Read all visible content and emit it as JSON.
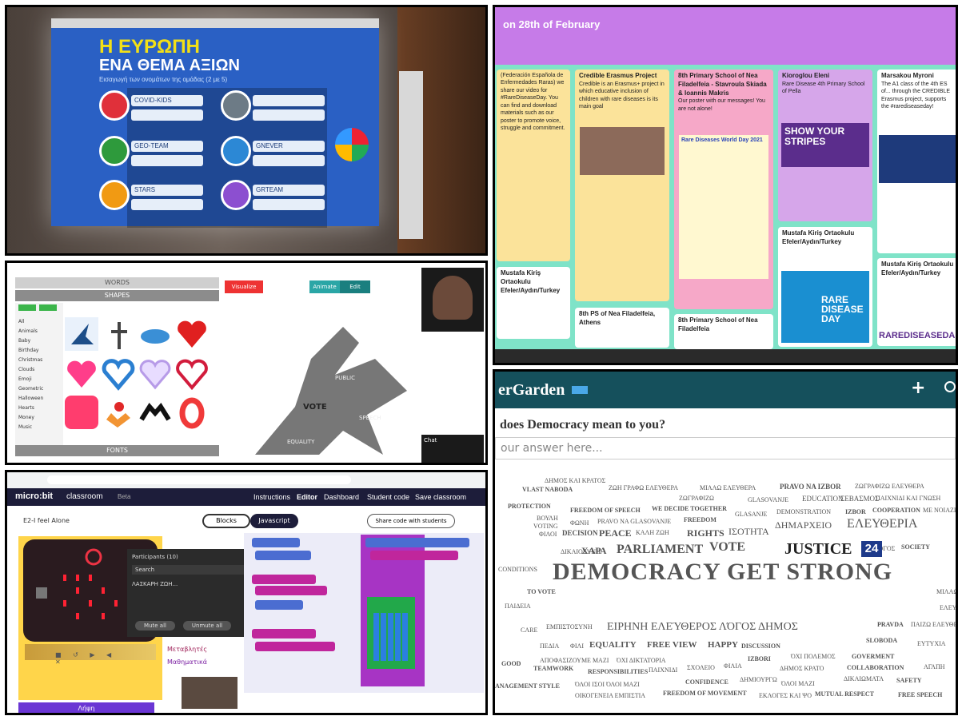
{
  "panel1": {
    "title_line1": "Η ΕΥΡΩΠΗ",
    "title_line2": "ΕΝΑ ΘΕΜΑ ΑΞΙΩΝ",
    "subtitle": "Εισαγωγή των ονομάτων της ομάδας (2 με 5)",
    "teams": [
      "COVID-KIDS",
      "GEO-TEAM",
      "STARS",
      "",
      "GNEVER",
      "GRTEAM"
    ]
  },
  "panel2": {
    "header_title": "on 28th of February",
    "columns": [
      {
        "title": "",
        "body": "(Federación Española de Enfermedades Raras) we share our video for #RareDiseaseDay. You can find and download materials such as our poster to promote voice, struggle and commitment."
      },
      {
        "title": "Credible Erasmus Project",
        "body": "Credible is an Erasmus+ project in which educative inclusion of children with rare diseases is its main goal"
      },
      {
        "title": "8th Primary School of Nea Filadelfeia - Stavroula Skiada & Ioannis Makris",
        "body": "Our poster with our messages! You are not alone!"
      },
      {
        "title": "Kioroglou Eleni",
        "body": "Rare Disease 4th Primary School of Pella"
      },
      {
        "title": "Marsakou Myroni",
        "body": "The A1 class of the 4th ES of... through the CREDIBLE Erasmus project, supports the #rarediseaseday!"
      }
    ],
    "poster_title": "Rare Diseases World Day 2021",
    "stripes_text": "SHOW YOUR STRIPES",
    "rare_text": "RARE DISEASE DAY",
    "tag_text": "RAREDISEASEDA",
    "bottom_cards": [
      "Mustafa Kiriş Ortaokulu Efeler/Aydın/Turkey",
      "8th PS of Nea Filadelfeia, Athens",
      "8th Primary School of Nea Filadelfeia",
      "Mustafa Kiriş Ortaokulu Efeler/Aydın/Turkey",
      "Mustafa Kiriş Ortaokulu Efeler/Aydın/Turkey"
    ]
  },
  "panel3": {
    "tab_words": "WORDS",
    "tab_shapes": "SHAPES",
    "tab_fonts": "FONTS",
    "categories": [
      "All",
      "Animals",
      "Baby",
      "Birthday",
      "Christmas",
      "Clouds",
      "Emoji",
      "Geometric",
      "Halloween",
      "Hearts",
      "Money",
      "Music"
    ],
    "btn_visualize": "Visualize",
    "btn_animate": "Animate",
    "btn_edit": "Edit",
    "chat_label": "Chat",
    "cloud_words": [
      "VOTE",
      "PUBLIC",
      "SPEECH",
      "EQUALITY"
    ]
  },
  "panel4": {
    "logo": "micro:bit",
    "product": "classroom",
    "beta": "Beta",
    "nav": [
      "Instructions",
      "Editor",
      "Dashboard",
      "Student code",
      "Save classroom"
    ],
    "project_name": "E2-I feel Alone",
    "tab_blocks": "Blocks",
    "tab_js": "Javascript",
    "share_button": "Share code with students",
    "participants_title": "Participants (10)",
    "search_placeholder": "Search",
    "participant_name": "ΛΑΣΚΑΡΗ ΖΩΗ...",
    "mute_all": "Mute all",
    "unmute_all": "Unmute all",
    "categories": [
      "Μεταβλητές",
      "Μαθηματικά"
    ],
    "download": "Λήψη"
  },
  "panel5": {
    "brand": "erGarden",
    "question": "does Democracy mean to you?",
    "placeholder": "our answer here...",
    "big_words": [
      "DEMOCRACY GET STRONG",
      "JUSTICE",
      "PARLIAMENT",
      "VOTE",
      "ΕΛΕΥΘΕΡΙΑ",
      "ΔΗΜΑΡΧΕΙΟ",
      "ΕΙΡΗΝΗ ΕΛΕΎΘΕΡΟΣ ΛΌΓΟΣ ΔΗΜΟΣ",
      "ΧΑΡΑ"
    ],
    "count": "24",
    "words": [
      "ΔΗΜΟΣ ΚΑΙ ΚΡΑΤΟΣ",
      "VLAST NABODA",
      "ΖΩΗ ΓΡΑΦΩ ΕΛΕΥΘΕΡΑ",
      "ΜΙΛΑΩ ΕΛΕΥΘΕΡΑ",
      "PRAVO NA IZBOR",
      "ΖΩΓΡΑΦΙΖΩ ΕΛΕΥΘΕΡΑ",
      "PROTECTION",
      "ΖΩΓΡΑΦΙΖΩ",
      "GLASOVANJE",
      "EDUCATION",
      "ΣΕΒΑΣΜΟΣ",
      "ΠΑΙΧΝΙΔΙ ΚΑΙ ΓΝΩΣΗ",
      "ΒΟΥΛΗ",
      "FREEDOM OF SPEECH",
      "WE DECIDE TOGETHER",
      "GLASANJE",
      "DEMONSTRATION",
      "IZBOR",
      "COOPERATION",
      "ΜΕ ΝΟΙΑΖΕΙ",
      "VOTING",
      "ΦΩΝΗ",
      "PRAVO NA GLASOVANJE",
      "FREEDOM",
      "ΦΙΛΟΙ",
      "DECISION",
      "PEACE",
      "ΚΑΛΗ ΖΩΗ",
      "RIGHTS",
      "ΙΣΟΤΗΤΑ",
      "ΔΙΚΑΙΟΣΥΝΗ",
      "ΛΟΓΟΣ",
      "SOCIETY",
      "CONDITIONS",
      "TO VOTE",
      "ΠΑΙΔΕΙΑ",
      "ΜΙΛΑΩ",
      "ΕΛΕΥ",
      "ΕΜΠΙΣΤΟΣΥΝΗ",
      "CARE",
      "PRAVDA",
      "ΠΑΙΖΩ ΕΛΕΥΘΕΡΑ",
      "ΠΕΔΙΑ",
      "ΦΙΛΙ",
      "EQUALITY",
      "FREE VIEW",
      "HAPPY",
      "DISCUSSION",
      "SLOBODA",
      "ΕΥΤΥΧΙΑ",
      "ΑΠΟΦΑΣΙΖΟΥΜΕ ΜΑΖΙ",
      "ΌΧΙ ΔΙΚΤΑΤΟΡΙΑ",
      "IZBORI",
      "ΌΧΙ ΠΟΛΕΜΟΣ",
      "GOVERMENT",
      "GOOD",
      "TEAMWORK",
      "RESPONSIBILITIES",
      "ΠΑΙΧΝΙΔΙ",
      "ΣΧΟΛΕΙΟ",
      "ΦΙΛΙΑ",
      "ΔΗΜΟΣ ΚΡΑΤΟ",
      "COLLABORATION",
      "ΑΓΑΠΗ",
      "ΌΛΟΙ ΙΣΟΙ ΌΛΟΙ ΜΑΖΙ",
      "CONFIDENCE",
      "ΔΗΜΙΟΥΡΓΩ",
      "ΌΛΟΙ ΜΑΖΙ",
      "ΔΙΚΑΙΩΜΑΤΑ",
      "SAFETY",
      "ANAGEMENT STYLE",
      "ΟΙΚΟΓΕΝΕΙΑ ΕΜΠΙΣΤΙΑ",
      "FREEDOM OF MOVEMENT",
      "ΕΚΛΟΓΕΣ ΚΑΙ ΨΟ",
      "MUTUAL RESPECT",
      "FREE SPEECH"
    ]
  }
}
